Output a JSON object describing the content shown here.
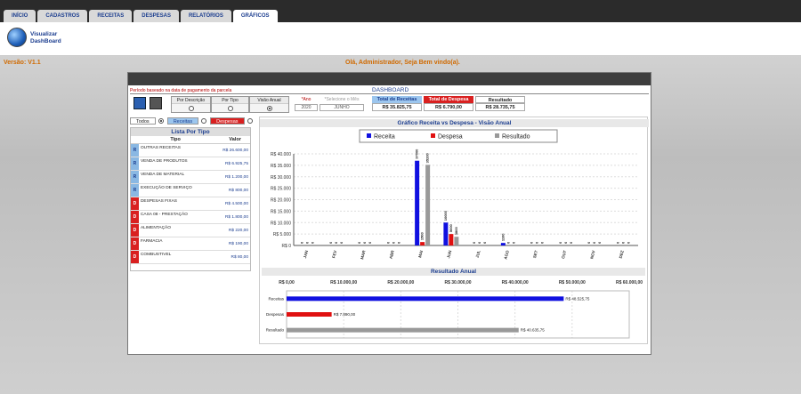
{
  "tabs": [
    "INÍCIO",
    "CADASTROS",
    "RECEITAS",
    "DESPESAS",
    "RELATÓRIOS",
    "GRÁFICOS"
  ],
  "header": {
    "logo_line1": "Visualizar",
    "logo_line2": "DashBoard"
  },
  "version": "Versão: V1.1",
  "welcome": "Olá, Administrador, Seja Bem vindo(a).",
  "dashboard": {
    "note": "Período baseado na data de pagamento da parcela",
    "title": "DASHBOARD",
    "options": [
      {
        "label": "Por Descrição",
        "selected": false
      },
      {
        "label": "Por Tipo",
        "selected": false
      },
      {
        "label": "Visão Anual",
        "selected": true
      }
    ],
    "ano_label": "*Ano",
    "ano_value": "2020",
    "mes_label": "*Selecione o Mês",
    "mes_value": "JUNHO",
    "total_receitas_label": "Total de Receitas",
    "total_receitas_value": "R$ 35.825,75",
    "total_despesa_label": "Total de Despesa",
    "total_despesa_value": "R$ 6.790,00",
    "resultado_label": "Resultado",
    "resultado_value": "R$ 28.735,75",
    "colors": {
      "receita": "#1010e0",
      "despesa": "#e01010",
      "resultado": "#999999"
    }
  },
  "filters": {
    "todos": "Todos",
    "receitas": "Receitas",
    "despesas": "Despesas",
    "selected": "todos"
  },
  "list": {
    "title": "Lista Por Tipo",
    "col_tipo": "Tipo",
    "col_valor": "Valor",
    "rows": [
      {
        "badge": "R",
        "name": "OUTRAS RECEITAS",
        "value": "R$ 26.600,00"
      },
      {
        "badge": "R",
        "name": "VENDA DE PRODUTOS",
        "value": "R$ 6.925,75"
      },
      {
        "badge": "R",
        "name": "VENDA DE MATERIAL",
        "value": "R$ 1.200,00"
      },
      {
        "badge": "R",
        "name": "EXECUÇÃO DE SERVIÇO",
        "value": "R$ 800,00"
      },
      {
        "badge": "D",
        "name": "DESPESAS FIXAS",
        "value": "R$ 4.500,00"
      },
      {
        "badge": "D",
        "name": "CASA 08 - PRESTAÇÃO",
        "value": "R$ 1.800,00"
      },
      {
        "badge": "D",
        "name": "ALIMENTAÇÃO",
        "value": "R$ 220,00"
      },
      {
        "badge": "D",
        "name": "FARMACIA",
        "value": "R$ 190,00"
      },
      {
        "badge": "D",
        "name": "COMBUSTIVEL",
        "value": "R$ 80,00"
      }
    ]
  },
  "chart_data": [
    {
      "type": "bar",
      "title": "Gráfico Receita vs Despesa - Visão Anual",
      "categories": [
        "JAN",
        "FEV",
        "MAR",
        "ABR",
        "MAI",
        "JUN",
        "JUL",
        "AGO",
        "SET",
        "OUT",
        "NOV",
        "DEZ"
      ],
      "series": [
        {
          "name": "Receita",
          "values": [
            0,
            0,
            0,
            0,
            37000,
            10000,
            0,
            1100,
            0,
            0,
            0,
            0
          ]
        },
        {
          "name": "Despesa",
          "values": [
            0,
            0,
            0,
            0,
            1500,
            5000,
            0,
            0,
            0,
            0,
            0,
            0
          ]
        },
        {
          "name": "Resultado",
          "values": [
            0,
            0,
            0,
            0,
            35200,
            3800,
            0,
            0,
            0,
            0,
            0,
            0
          ]
        }
      ],
      "ylim": [
        0,
        40000
      ],
      "yticks": [
        "R$ 0",
        "R$ 5.000",
        "R$ 10.000",
        "R$ 15.000",
        "R$ 20.000",
        "R$ 25.000",
        "R$ 30.000",
        "R$ 35.000",
        "R$ 40.000"
      ],
      "legend": "top"
    },
    {
      "type": "bar",
      "orientation": "horizontal",
      "title": "Resultado Anual",
      "categories": [
        "Receitas",
        "Despesas",
        "Resultado"
      ],
      "values": [
        48525.75,
        7890.0,
        40635.75
      ],
      "value_labels": [
        "R$ 48.525,75",
        "R$ 7.890,00",
        "R$ 40.635,75"
      ],
      "xlim": [
        0,
        60000
      ],
      "xticks": [
        "R$ 0,00",
        "R$ 10.000,00",
        "R$ 20.000,00",
        "R$ 30.000,00",
        "R$ 40.000,00",
        "R$ 50.000,00",
        "R$ 60.000,00"
      ],
      "colors": [
        "#1010e0",
        "#e01010",
        "#999999"
      ]
    }
  ]
}
